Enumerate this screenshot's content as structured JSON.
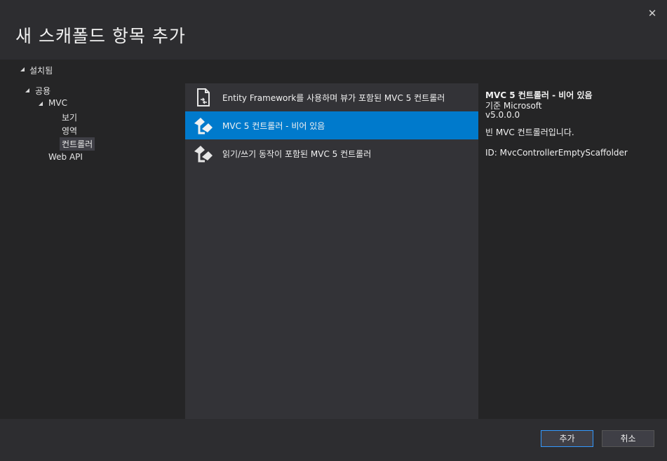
{
  "dialog": {
    "title": "새 스캐폴드 항목 추가",
    "close_glyph": "✕"
  },
  "installed": {
    "label": "설치됨"
  },
  "tree": {
    "common": "공용",
    "mvc": "MVC",
    "view": "보기",
    "area": "영역",
    "controller": "컨트롤러",
    "webapi": "Web API"
  },
  "items": [
    {
      "label": "Entity Framework를 사용하며 뷰가 포함된 MVC 5 컨트롤러",
      "icon": "document-arrows-icon"
    },
    {
      "label": "MVC 5 컨트롤러 - 비어 있음",
      "icon": "controller-icon"
    },
    {
      "label": "읽기/쓰기 동작이 포함된 MVC 5 컨트롤러",
      "icon": "controller-icon"
    }
  ],
  "details": {
    "name": "MVC 5 컨트롤러 - 비어 있음",
    "by": "기준 Microsoft",
    "version": "v5.0.0.0",
    "description": "빈 MVC 컨트롤러입니다.",
    "id": "ID: MvcControllerEmptyScaffolder"
  },
  "buttons": {
    "add": "추가",
    "cancel": "취소"
  },
  "colors": {
    "selection": "#007acc",
    "background": "#252526",
    "list_background": "#333337"
  }
}
